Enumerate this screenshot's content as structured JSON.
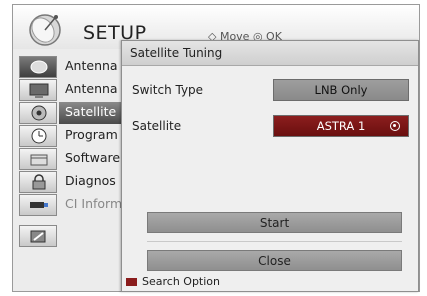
{
  "setup": {
    "title": "SETUP",
    "hint": "◇ Move  ◎ OK",
    "items": [
      {
        "label": "Antenna",
        "icon": "satellite-dish-icon"
      },
      {
        "label": "Antenna",
        "icon": "tv-screen-icon"
      },
      {
        "label": "Satellite",
        "icon": "disc-icon"
      },
      {
        "label": "Program",
        "icon": "clock-icon"
      },
      {
        "label": "Software",
        "icon": "box-icon"
      },
      {
        "label": "Diagnos",
        "icon": "lock-icon"
      },
      {
        "label": "CI Inform",
        "icon": "card-icon"
      },
      {
        "label": "",
        "icon": "tools-icon"
      }
    ],
    "selected_index": 2
  },
  "dialog": {
    "title": "Satellite Tuning",
    "switch_type_label": "Switch Type",
    "switch_type_value": "LNB Only",
    "satellite_label": "Satellite",
    "satellite_value": "ASTRA 1",
    "start_label": "Start",
    "close_label": "Close",
    "legend_label": "Search Option",
    "legend_color": "#8a1c1c",
    "focus_color": "#7a1414"
  }
}
